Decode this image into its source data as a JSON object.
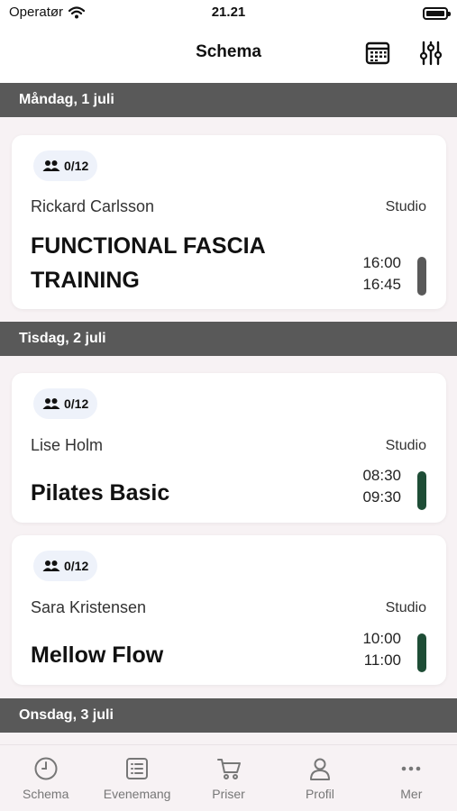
{
  "status": {
    "carrier": "Operatør",
    "time": "21.21"
  },
  "header": {
    "title": "Schema"
  },
  "days": [
    {
      "label": "Måndag, 1 juli"
    },
    {
      "label": "Tisdag, 2 juli"
    },
    {
      "label": "Onsdag, 3 juli"
    }
  ],
  "classes": [
    {
      "capacity": "0/12",
      "instructor": "Rickard Carlsson",
      "room": "Studio",
      "name_line1": "FUNCTIONAL FASCIA",
      "name_line2": "TRAINING",
      "start": "16:00",
      "end": "16:45",
      "bar_color": "#595959"
    },
    {
      "capacity": "0/12",
      "instructor": "Lise Holm",
      "room": "Studio",
      "name": "Pilates Basic",
      "start": "08:30",
      "end": "09:30",
      "bar_color": "#1e4d36"
    },
    {
      "capacity": "0/12",
      "instructor": "Sara Kristensen",
      "room": "Studio",
      "name": "Mellow Flow",
      "start": "10:00",
      "end": "11:00",
      "bar_color": "#1e4d36"
    }
  ],
  "tabs": [
    {
      "label": "Schema",
      "icon": "clock-icon"
    },
    {
      "label": "Evenemang",
      "icon": "list-icon"
    },
    {
      "label": "Priser",
      "icon": "cart-icon"
    },
    {
      "label": "Profil",
      "icon": "person-icon"
    },
    {
      "label": "Mer",
      "icon": "more-icon"
    }
  ]
}
